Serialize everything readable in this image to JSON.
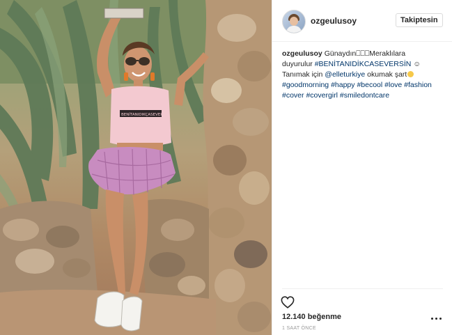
{
  "post": {
    "image_alt": "Photo of a woman in a pink crop top and frilled skirt posing against a stone wall",
    "image_label_text": "BENİTANIDIKÇASEVERSİN"
  },
  "header": {
    "username": "ozgeulusoy",
    "follow_label": "Takiptesin"
  },
  "caption": {
    "username": "ozgeulusoy",
    "text_1": "Günaydın",
    "boxes": "⎕⎕⎕",
    "text_2": "Meraklılara duyurulur",
    "tag_benitanidik": "#BENİTANIDİKCASEVERSİN",
    "symbol": "☺",
    "text_3": "Tanımak için",
    "mention": "@elleturkiye",
    "text_4": "okumak şart",
    "hashtags": [
      "#goodmorning",
      "#happy",
      "#becool",
      "#love",
      "#fashion",
      "#cover",
      "#covergirl",
      "#smiledontcare"
    ]
  },
  "footer": {
    "likes": "12.140 beğenme",
    "time": "1 SAAT ÖNCE"
  },
  "icons": {
    "like": "heart-outline-icon",
    "more": "ellipsis-icon"
  }
}
